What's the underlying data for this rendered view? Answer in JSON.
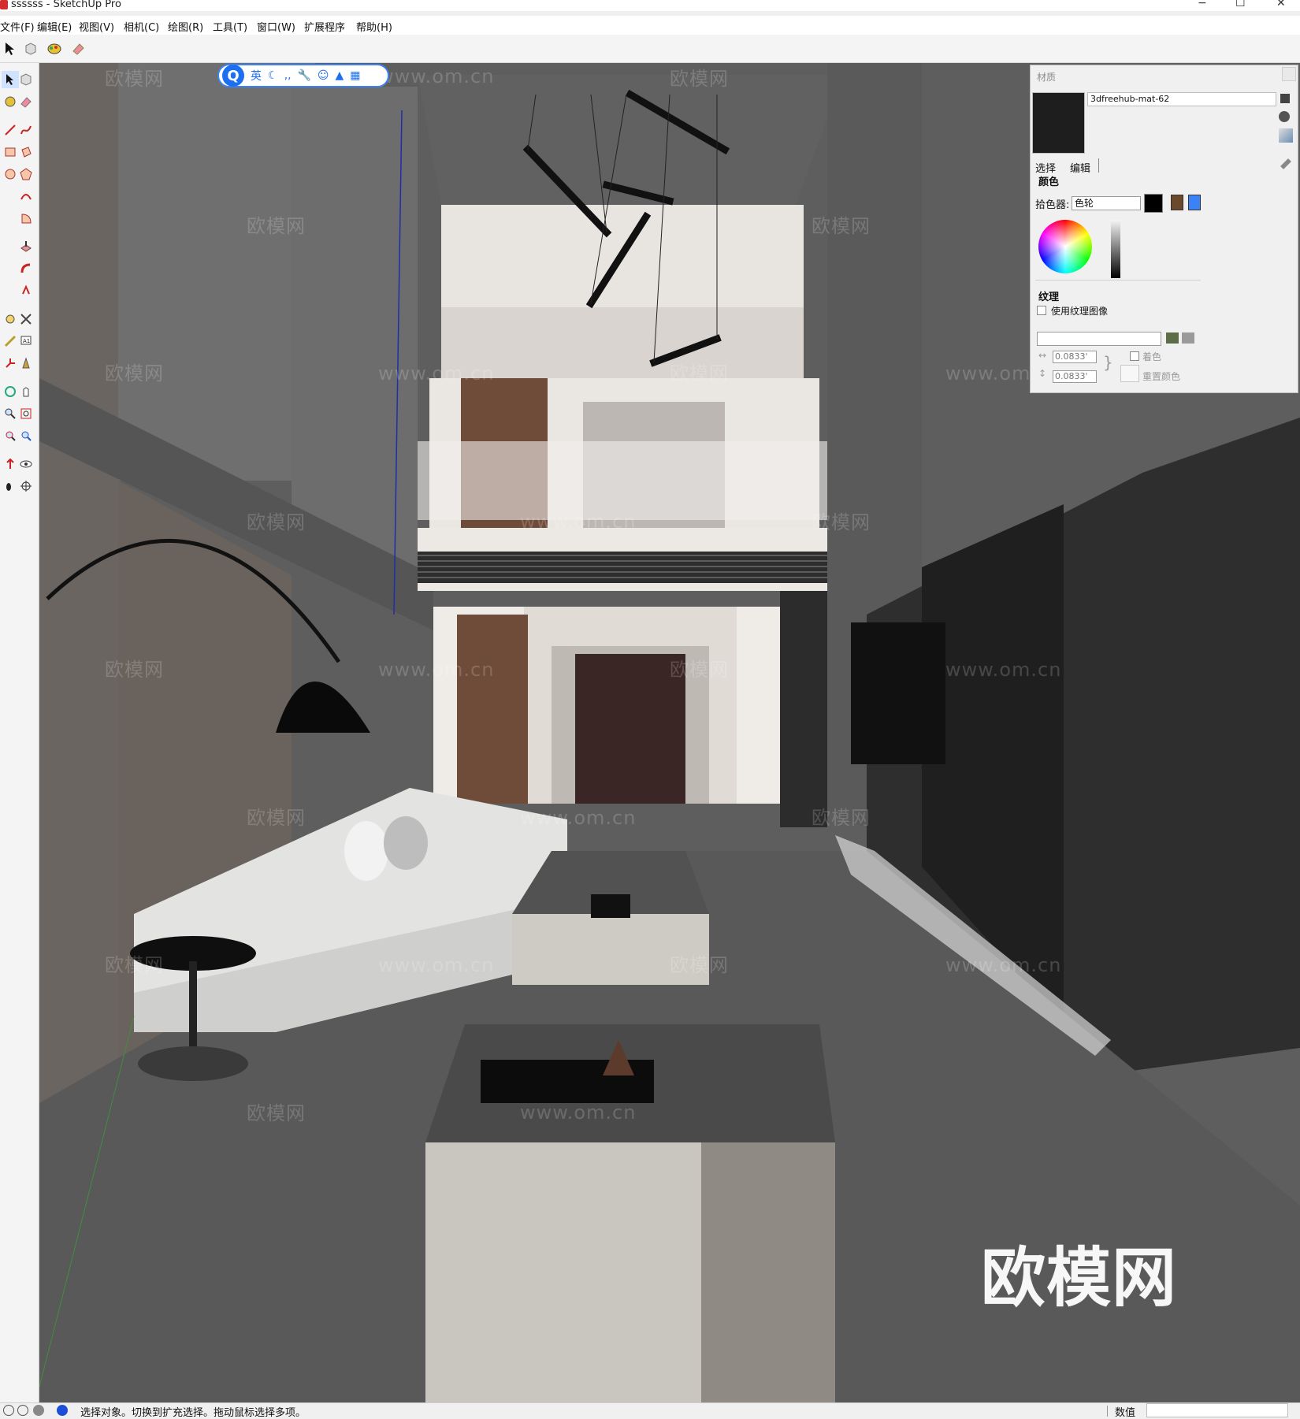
{
  "titlebar": {
    "title": "ssssss - SketchUp Pro",
    "minimize": "−",
    "maximize": "☐",
    "close": "✕"
  },
  "menu": [
    "文件(F)",
    "编辑(E)",
    "视图(V)",
    "相机(C)",
    "绘图(R)",
    "工具(T)",
    "窗口(W)",
    "扩展程序",
    "帮助(H)"
  ],
  "ime": {
    "logo": "Q",
    "lang": "英"
  },
  "panel": {
    "title": "材质",
    "material_name": "3dfreehub-mat-62",
    "tabs": {
      "select": "选择",
      "edit": "编辑"
    },
    "color_label": "颜色",
    "picker_label": "拾色器:",
    "picker_value": "色轮",
    "texture_label": "纹理",
    "use_texture": "使用纹理图像",
    "width": "0.0833'",
    "height": "0.0833'",
    "colorize": "着色",
    "reset_color": "重置颜色"
  },
  "statusbar": {
    "text": "选择对象。切换到扩充选择。拖动鼠标选择多项。",
    "measure_label": "数值"
  },
  "watermarks": {
    "site": "www.om.cn",
    "brand": "欧模网"
  }
}
